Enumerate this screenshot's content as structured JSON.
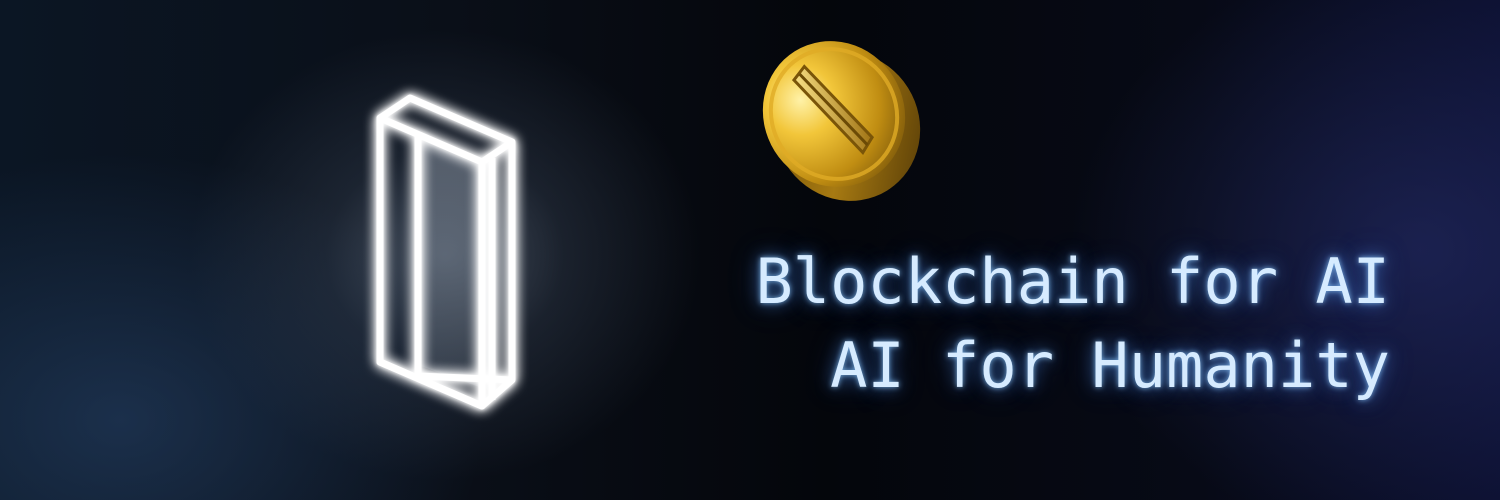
{
  "tagline": {
    "line1": "Blockchain for AI",
    "line2": "AI for Humanity"
  },
  "icons": {
    "glow_logo": "glowing-prism-logo-icon",
    "coin": "gold-coin-icon"
  },
  "colors": {
    "glow": "#ffffff",
    "text": "#d6ebff",
    "coin_gold": "#d4a017",
    "background": "#05080f"
  }
}
